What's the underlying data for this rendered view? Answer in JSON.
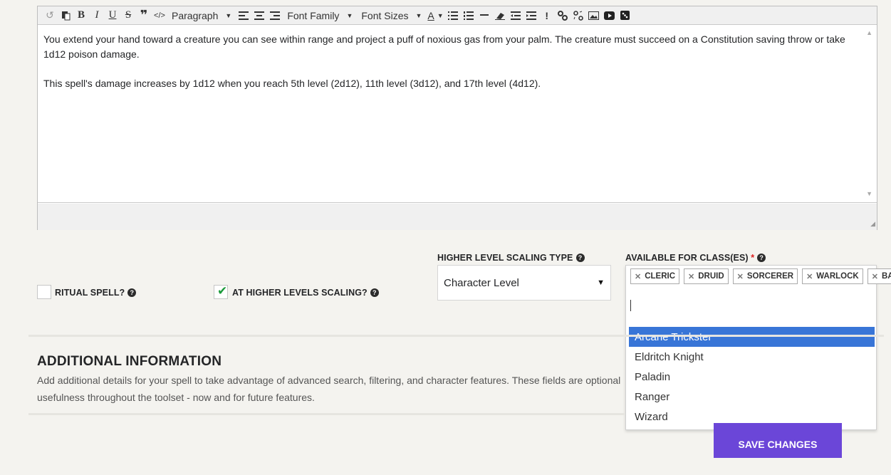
{
  "toolbar": {
    "paragraph": "Paragraph",
    "font_family": "Font Family",
    "font_sizes": "Font Sizes",
    "text_color_letter": "A",
    "bold": "B",
    "italic": "I",
    "underline": "U",
    "strikethrough": "S",
    "exclaim": "!"
  },
  "editor": {
    "paragraph_1": "You extend your hand toward a creature you can see within range and project a puff of noxious gas from your palm. The creature must succeed on a Constitution saving throw or take 1d12 poison damage.",
    "paragraph_2": "This spell's damage increases by 1d12 when you reach 5th level (2d12), 11th level (3d12), and 17th level (4d12)."
  },
  "ritual": {
    "label": "Ritual Spell?",
    "checked": false
  },
  "higher_levels": {
    "label": "At Higher Levels Scaling?",
    "checked": true
  },
  "scaling_type": {
    "label": "Higher Level Scaling Type",
    "value": "Character Level"
  },
  "classes": {
    "label": "Available for Class(es)",
    "required_mark": "*",
    "selected": [
      "Cleric",
      "Druid",
      "Sorcerer",
      "Warlock",
      "Bard"
    ],
    "options": [
      "Arcane Trickster",
      "Eldritch Knight",
      "Paladin",
      "Ranger",
      "Wizard"
    ],
    "highlighted": "Arcane Trickster"
  },
  "additional": {
    "title": "ADDITIONAL INFORMATION",
    "line_1": "Add additional details for your spell to take advantage of advanced search, filtering, and character features. These fields are optional, b",
    "line_2": "usefulness throughout the toolset - now and for future features."
  },
  "save_button": "Save Changes",
  "colors": {
    "accent": "#6b46d8",
    "highlight": "#3875d7",
    "check": "#1b9a3b"
  }
}
